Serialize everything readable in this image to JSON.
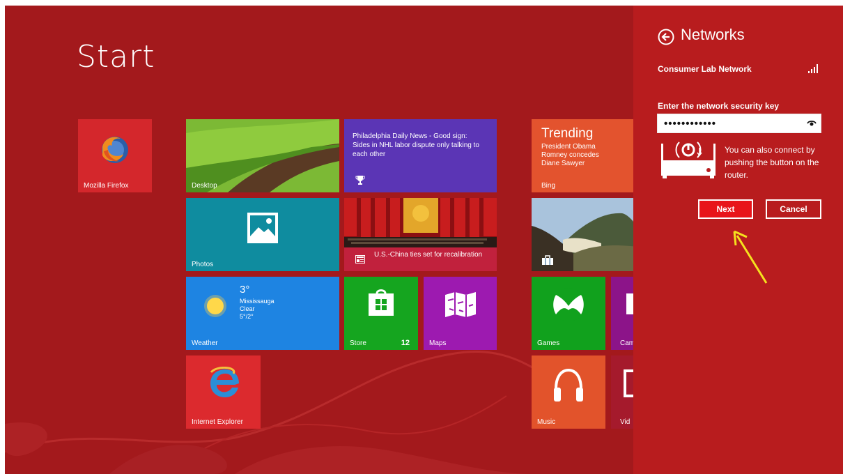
{
  "start": {
    "title": "Start"
  },
  "tiles": {
    "firefox": {
      "label": "Mozilla Firefox"
    },
    "desktop": {
      "label": "Desktop"
    },
    "news": {
      "text": "Philadelphia Daily News - Good sign: Sides in NHL labor dispute only talking to each other"
    },
    "trending": {
      "title": "Trending",
      "items": [
        "President Obama",
        "Romney concedes",
        "Diane Sawyer"
      ],
      "label": "Bing"
    },
    "photos": {
      "label": "Photos"
    },
    "headline": {
      "text": "U.S.-China ties set for recalibration"
    },
    "weather": {
      "temp": "3°",
      "city": "Mississauga",
      "condition": "Clear",
      "range": "5°/2°",
      "label": "Weather"
    },
    "store": {
      "label": "Store",
      "badge": "12"
    },
    "maps": {
      "label": "Maps"
    },
    "games": {
      "label": "Games"
    },
    "camera": {
      "label": "Cam"
    },
    "ie": {
      "label": "Internet Explorer"
    },
    "music": {
      "label": "Music"
    },
    "video": {
      "label": "Vid"
    }
  },
  "panel": {
    "title": "Networks",
    "network_name": "Consumer Lab Network",
    "key_label": "Enter the network security key",
    "key_value": "••••••••••••",
    "wps_text": "You can also connect by pushing the button on the router.",
    "next_label": "Next",
    "cancel_label": "Cancel"
  },
  "colors": {
    "background": "#a3191c",
    "panel": "#b81c1e",
    "next_button": "#e8141a",
    "annotation_arrow": "#f5e11e"
  }
}
